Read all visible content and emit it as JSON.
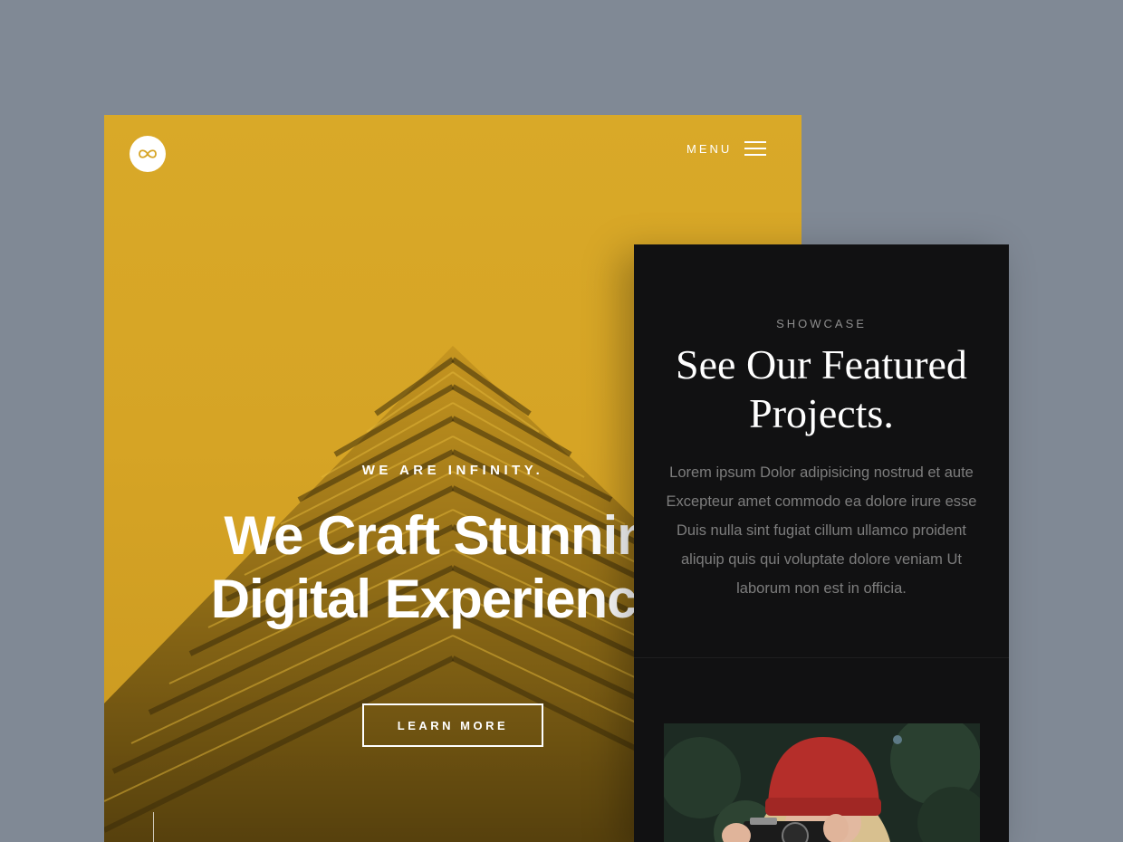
{
  "hero": {
    "menu_label": "MENU",
    "eyebrow": "WE ARE INFINITY.",
    "title_line1": "We Craft Stunning",
    "title_line2": "Digital Experiences",
    "cta_label": "LEARN MORE"
  },
  "showcase": {
    "eyebrow": "SHOWCASE",
    "title_line1": "See Our Featured",
    "title_line2": "Projects.",
    "body": "Lorem ipsum Dolor adipisicing nostrud et aute Excepteur amet commodo ea dolore irure esse Duis nulla sint fugiat cillum ullamco proident aliquip quis qui voluptate dolore veniam Ut laborum non est in officia."
  },
  "icons": {
    "logo": "infinity-icon",
    "menu": "hamburger-icon"
  },
  "colors": {
    "backdrop": "#808995",
    "hero_yellow": "#d9a928",
    "showcase_dark": "#111112",
    "text_white": "#ffffff",
    "muted_text": "#7d7d7d"
  }
}
